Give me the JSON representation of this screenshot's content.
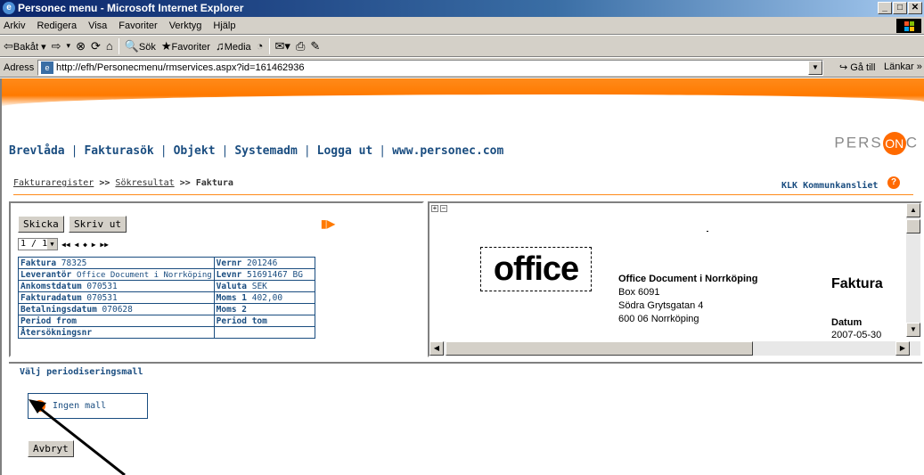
{
  "window": {
    "title": "Personec menu - Microsoft Internet Explorer",
    "min": "_",
    "max": "□",
    "close": "✕"
  },
  "menu": [
    "Arkiv",
    "Redigera",
    "Visa",
    "Favoriter",
    "Verktyg",
    "Hjälp"
  ],
  "toolbar": {
    "back": "Bakåt",
    "search": "Sök",
    "favorites": "Favoriter",
    "media": "Media"
  },
  "address": {
    "label": "Adress",
    "url": "http://efh/Personecmenu/rmservices.aspx?id=161462936",
    "goto": "Gå till",
    "links": "Länkar"
  },
  "nav": [
    "Brevlåda",
    "Fakturasök",
    "Objekt",
    "Systemadm",
    "Logga ut",
    "www.personec.com"
  ],
  "logo": {
    "pre": "PERS",
    "mid": "ON",
    "post": "C"
  },
  "breadcrumb": {
    "item1": "Fakturaregister",
    "sep": ">>",
    "item2": "Sökresultat",
    "current": "Faktura"
  },
  "org": "KLK Kommunkansliet",
  "left": {
    "send": "Skicka",
    "print": "Skriv ut",
    "page": "1 / 1",
    "pager_nav": "◀◀ ◀ ◆ ▶ ▶▶",
    "rows": [
      {
        "l_label": "Faktura",
        "l_value": "78325",
        "r_label": "Vernr",
        "r_value": "201246"
      },
      {
        "l_label": "Leverantör",
        "l_value": "Office Document i Norrköping",
        "r_label": "Levnr",
        "r_value": "51691467 BG"
      },
      {
        "l_label": "Ankomstdatum",
        "l_value": "070531",
        "r_label": "Valuta",
        "r_value": "SEK"
      },
      {
        "l_label": "Fakturadatum",
        "l_value": "070531",
        "r_label": "Moms 1",
        "r_value": "402,00"
      },
      {
        "l_label": "Betalningsdatum",
        "l_value": "070628",
        "r_label": "Moms 2",
        "r_value": ""
      },
      {
        "l_label": "Period from",
        "l_value": "",
        "r_label": "Period tom",
        "r_value": ""
      },
      {
        "l_label": "Återsökningsnr",
        "l_value": "",
        "r_label": "",
        "r_value": ""
      }
    ]
  },
  "invoice": {
    "logo_text": "office",
    "sender_name": "Office Document i Norrköping",
    "box": "Box 6091",
    "street": "Södra Grytsgatan 4",
    "city": "600 06 Norrköping",
    "title": "Faktura",
    "datum_label": "Datum",
    "datum_value": "2007-05-30"
  },
  "bottom": {
    "heading": "Välj periodiseringsmall",
    "option": "Ingen mall",
    "cancel": "Avbryt"
  }
}
